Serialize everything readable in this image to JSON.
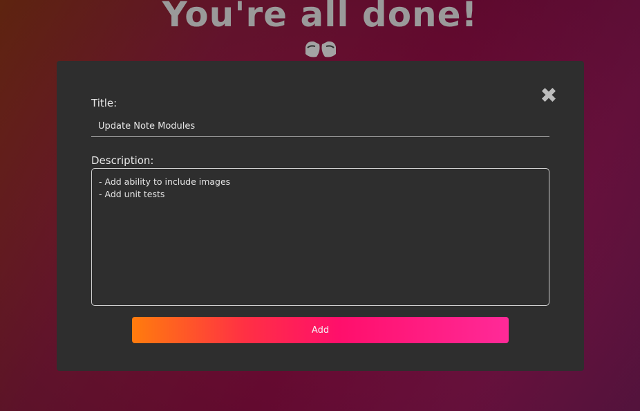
{
  "hero": {
    "title": "You're all done!",
    "icon": "toast-glasses-icon"
  },
  "modal": {
    "close_glyph": "✖",
    "title_label": "Title:",
    "title_value": "Update Note Modules",
    "description_label": "Description:",
    "description_value": "- Add ability to include images\n- Add unit tests",
    "add_button_label": "Add"
  },
  "colors": {
    "modal_bg": "#2e2e2e",
    "button_gradient_start": "#ff7c0d",
    "button_gradient_end": "#ff2a98"
  }
}
